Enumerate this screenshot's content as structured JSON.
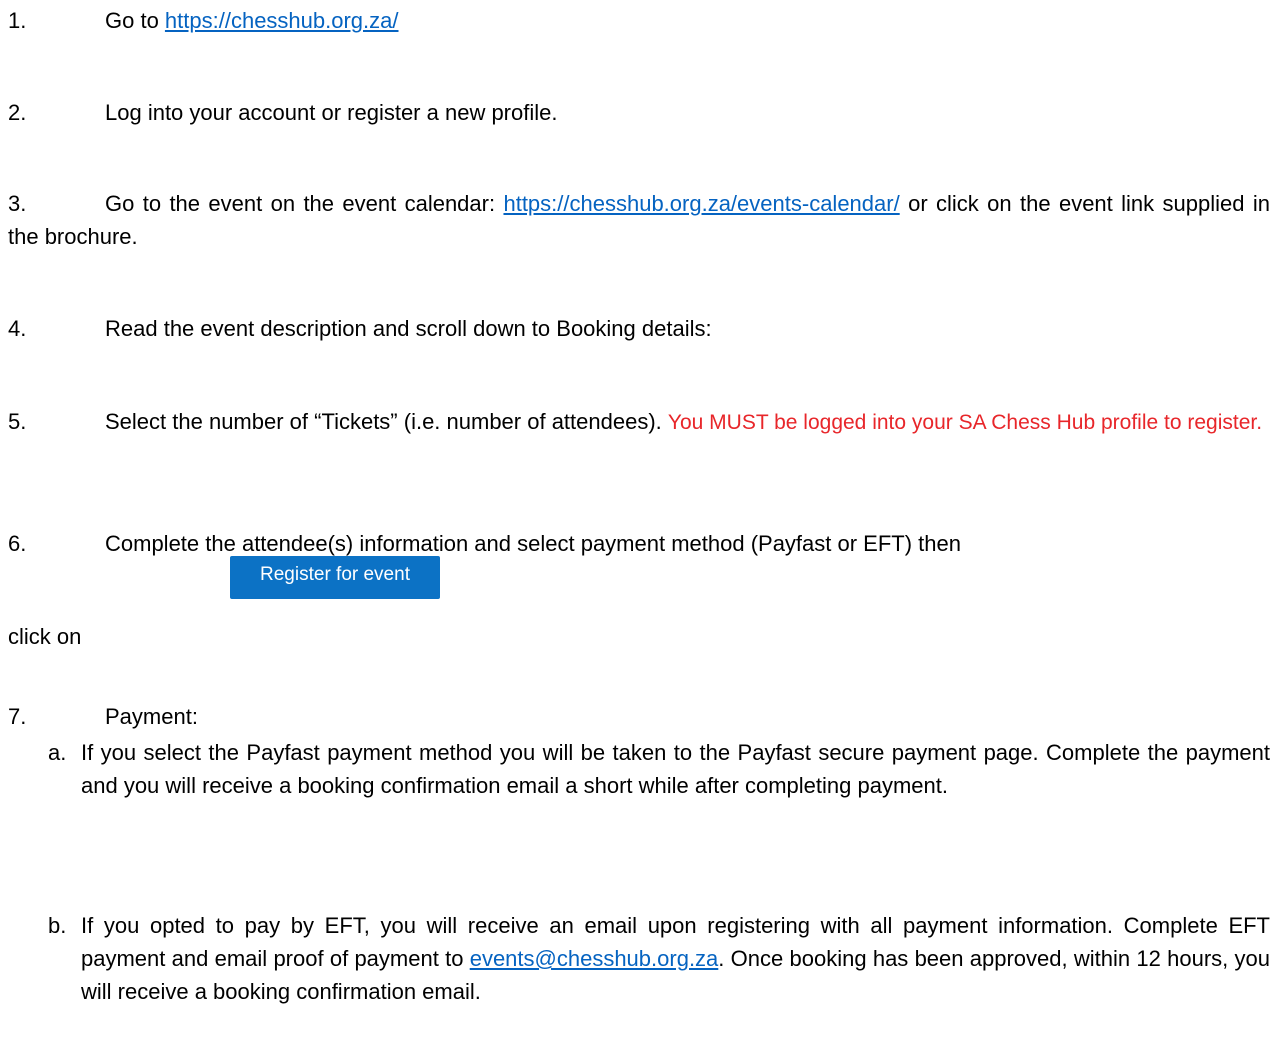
{
  "steps": [
    {
      "num": "1.",
      "pre": "Go to ",
      "link": "https://chesshub.org.za/"
    },
    {
      "num": "2.",
      "text": "Log into your account or register a new profile."
    },
    {
      "num": "3.",
      "pre": "Go to the event on the event calendar: ",
      "link": "https://chesshub.org.za/events-calendar/",
      "post": "  or click on the event link supplied in the brochure."
    },
    {
      "num": "4.",
      "text": "Read the event description and scroll down to Booking details:"
    },
    {
      "num": "5.",
      "text": "Select the number of “Tickets” (i.e. number of attendees).  ",
      "warning": "You MUST be logged into your SA Chess Hub profile to register."
    },
    {
      "num": "6.",
      "text": "Complete the attendee(s) information and select payment method (Payfast or EFT) then",
      "click_on": "click on",
      "button_label": "Register for event"
    },
    {
      "num": "7.",
      "text": "Payment:"
    }
  ],
  "substeps": [
    {
      "letter": "a.",
      "text": "If you select the Payfast payment method you will be taken to the Payfast secure payment page. Complete the payment and you will receive a booking confirmation email a short while after completing payment."
    },
    {
      "letter": "b.",
      "pre": "If you opted to pay by EFT, you will receive an email upon registering with all payment information. Complete EFT payment and email proof of payment to ",
      "link": "events@chesshub.org.za",
      "post": ". Once booking has been approved, within 12 hours, you will receive a booking confirmation email."
    }
  ],
  "colors": {
    "link": "#0563C1",
    "warning": "#E8262A",
    "button": "#0C72C5"
  }
}
